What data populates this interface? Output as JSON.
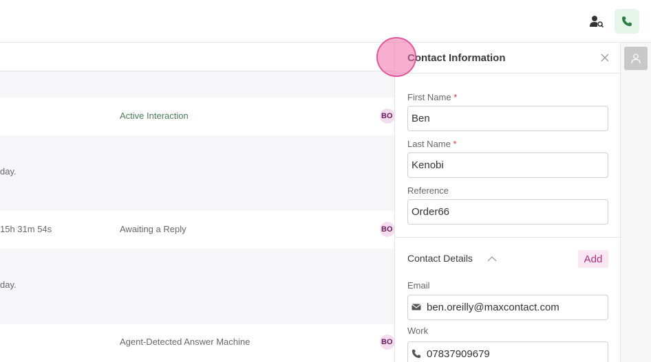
{
  "topbar": {
    "contact_search_icon": "contact-search-icon",
    "phone_icon": "phone-icon",
    "phone_color": "#2e7d44"
  },
  "list": {
    "rows": [
      {
        "time": "",
        "status": "Active Interaction",
        "badge": "BO"
      },
      {
        "time": "day.",
        "status": "",
        "badge": ""
      },
      {
        "time": "15h 31m 54s",
        "status": "Awaiting a Reply",
        "badge": "BO"
      },
      {
        "time": "day.",
        "status": "",
        "badge": ""
      },
      {
        "time": "",
        "status": "Agent-Detected Answer Machine",
        "badge": "BO"
      }
    ]
  },
  "panel": {
    "title": "Contact Information",
    "close_icon": "close-icon",
    "first_name_label": "First Name",
    "first_name_value": "Ben",
    "last_name_label": "Last Name",
    "last_name_value": "Kenobi",
    "required_marker": "*",
    "reference_label": "Reference",
    "reference_value": "Order66",
    "contact_details_title": "Contact Details",
    "add_label": "Add",
    "email_label": "Email",
    "email_value": "ben.oreilly@maxcontact.com",
    "work_label": "Work",
    "work_value": "07837909679"
  },
  "rightbar": {
    "avatar_icon": "user-avatar-icon"
  },
  "colors": {
    "accent": "#b0307e",
    "accent_bg": "#fbe6f4",
    "status_active": "#4a7c59",
    "badge_bg": "#f3dcee"
  }
}
